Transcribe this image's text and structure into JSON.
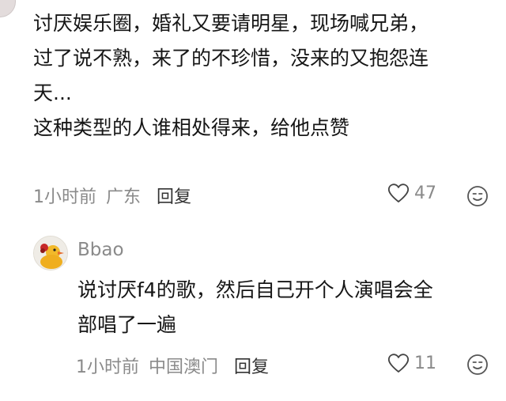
{
  "comment": {
    "text": "讨厌娱乐圈，婚礼又要请明星，现场喊兄弟，\n过了说不熟，来了的不珍惜，没来的又抱怨连\n天...\n这种类型的人谁相处得来，给他点赞",
    "time": "1小时前",
    "location": "广东",
    "reply_label": "回复",
    "likes": "47"
  },
  "reply": {
    "username": "Bbao",
    "text": "说讨厌f4的歌，然后自己开个人演唱会全\n部唱了一遍",
    "time": "1小时前",
    "location": "中国澳门",
    "reply_label": "回复",
    "likes": "11"
  }
}
